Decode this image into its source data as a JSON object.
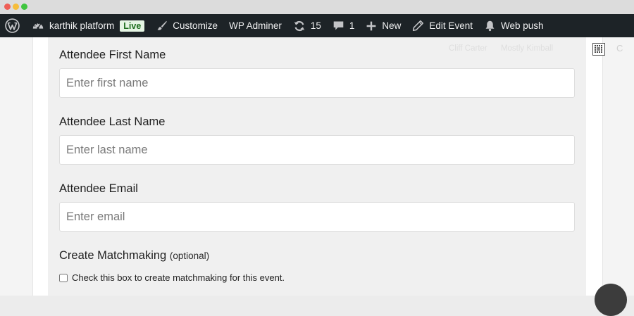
{
  "adminbar": {
    "site_name": "karthik platform",
    "live_badge": "Live",
    "customize": "Customize",
    "wp_adminer": "WP Adminer",
    "updates_count": "15",
    "comments_count": "1",
    "new": "New",
    "edit_event": "Edit Event",
    "web_push": "Web push"
  },
  "faded_header": {
    "item1": "Cliff Carter",
    "item2": "Mostly Kimball"
  },
  "form": {
    "first_name": {
      "label": "Attendee First Name",
      "placeholder": "Enter first name",
      "value": ""
    },
    "last_name": {
      "label": "Attendee Last Name",
      "placeholder": "Enter last name",
      "value": ""
    },
    "email": {
      "label": "Attendee Email",
      "placeholder": "Enter email",
      "value": ""
    },
    "matchmaking": {
      "label": "Create Matchmaking",
      "optional_note": "(optional)",
      "checkbox_label": "Check this box to create matchmaking for this event.",
      "checked": false
    }
  },
  "icons": {
    "wordpress": "wordpress-logo-icon",
    "dashboard": "dashboard-gauge-icon",
    "customize": "brush-icon",
    "updates": "refresh-icon",
    "comments": "comment-bubble-icon",
    "new": "plus-icon",
    "edit": "pencil-icon",
    "web_push": "bell-icon"
  },
  "colors": {
    "adminbar_bg": "#1d2327",
    "adminbar_text": "#f0f0f1",
    "live_badge_bg": "#e5f5e3",
    "live_badge_text": "#1e6e1e",
    "form_panel_bg": "#f0f0f0"
  }
}
